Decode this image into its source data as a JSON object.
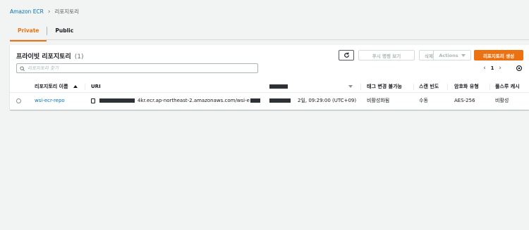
{
  "breadcrumb": {
    "root": "Amazon ECR",
    "current": "리포지토리"
  },
  "tabs": [
    {
      "label": "Private",
      "active": true
    },
    {
      "label": "Public",
      "active": false
    }
  ],
  "panel": {
    "title": "프라이빗 리포지토리",
    "count": "(1)",
    "buttons": {
      "push_commands": "푸시 명령 보기",
      "delete": "삭제",
      "actions": "Actions",
      "create": "리포지토리 생성"
    },
    "search_placeholder": "리포지토리 찾기",
    "pagination": {
      "current_page": "1"
    }
  },
  "table": {
    "columns": {
      "name": "리포지토리 이름",
      "uri": "URI",
      "created": "",
      "tag_immutability": "태그 변경 불가능",
      "scan_frequency": "스캔 빈도",
      "encryption": "암호화 유형",
      "pull_through_cache": "풀스루 캐시"
    },
    "rows": [
      {
        "name": "wsi-ecr-repo",
        "uri_visible_part": "4kr.ecr.ap-northeast-2.amazonaws.com/wsi-e",
        "created_visible_part": "2일, 09:29:00 (UTC+09)",
        "tag_immutability": "비활성화됨",
        "scan_frequency": "수동",
        "encryption": "AES-256",
        "pull_through_cache": "비활성"
      }
    ]
  },
  "colors": {
    "accent": "#ec7211",
    "link": "#0073bb",
    "background": "#f2f3f3"
  }
}
